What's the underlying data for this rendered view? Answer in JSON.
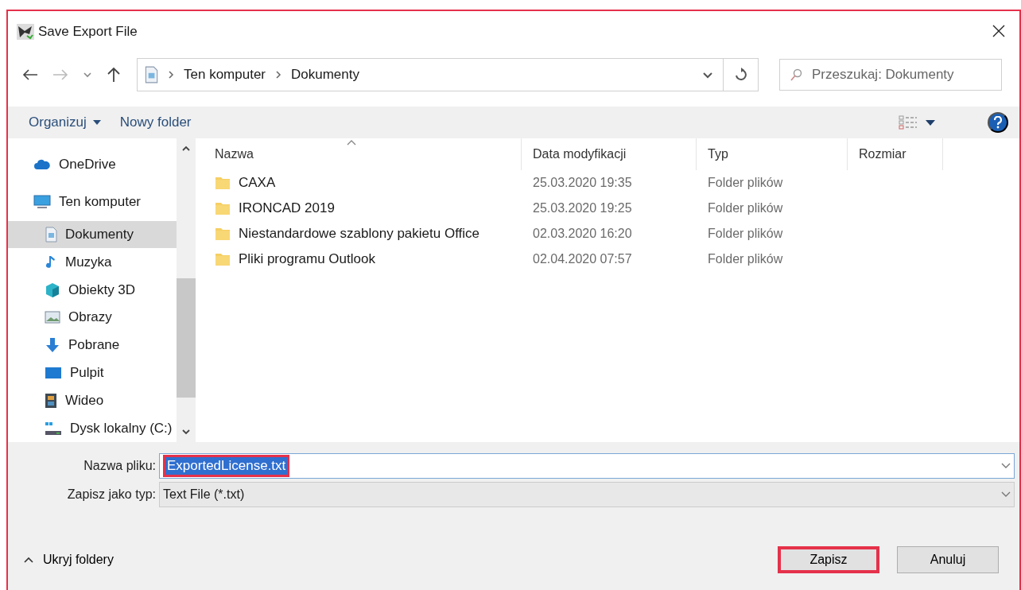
{
  "window": {
    "title": "Save Export File"
  },
  "breadcrumb": [
    "Ten komputer",
    "Dokumenty"
  ],
  "search": {
    "placeholder": "Przeszukaj: Dokumenty"
  },
  "toolbar": {
    "organize": "Organizuj",
    "new_folder": "Nowy folder"
  },
  "sidebar": {
    "items": [
      {
        "label": "OneDrive",
        "kind": "cloud",
        "selected": false
      },
      {
        "label": "Ten komputer",
        "kind": "computer",
        "selected": false,
        "children": [
          {
            "label": "Dokumenty",
            "kind": "document",
            "selected": true
          },
          {
            "label": "Muzyka",
            "kind": "music",
            "selected": false
          },
          {
            "label": "Obiekty 3D",
            "kind": "cube",
            "selected": false
          },
          {
            "label": "Obrazy",
            "kind": "image",
            "selected": false
          },
          {
            "label": "Pobrane",
            "kind": "download",
            "selected": false
          },
          {
            "label": "Pulpit",
            "kind": "desktop",
            "selected": false
          },
          {
            "label": "Wideo",
            "kind": "video",
            "selected": false
          },
          {
            "label": "Dysk lokalny (C:)",
            "kind": "drive",
            "selected": false
          }
        ]
      }
    ]
  },
  "table": {
    "columns": [
      "Nazwa",
      "Data modyfikacji",
      "Typ",
      "Rozmiar"
    ],
    "rows": [
      {
        "name": "CAXA",
        "modified": "25.03.2020 19:35",
        "type": "Folder plików"
      },
      {
        "name": "IRONCAD 2019",
        "modified": "25.03.2020 19:25",
        "type": "Folder plików"
      },
      {
        "name": "Niestandardowe szablony pakietu Office",
        "modified": "02.03.2020 16:20",
        "type": "Folder plików"
      },
      {
        "name": "Pliki programu Outlook",
        "modified": "02.04.2020 07:57",
        "type": "Folder plików"
      }
    ]
  },
  "filename": {
    "label": "Nazwa pliku:",
    "value": "ExportedLicense.txt",
    "text_selected": true,
    "highlighted": true
  },
  "filetype": {
    "label": "Zapisz jako typ:",
    "value": "Text File (*.txt)"
  },
  "hide_folders": "Ukryj foldery",
  "buttons": [
    {
      "label": "Zapisz",
      "highlighted": true
    },
    {
      "label": "Anuluj",
      "highlighted": false
    }
  ]
}
